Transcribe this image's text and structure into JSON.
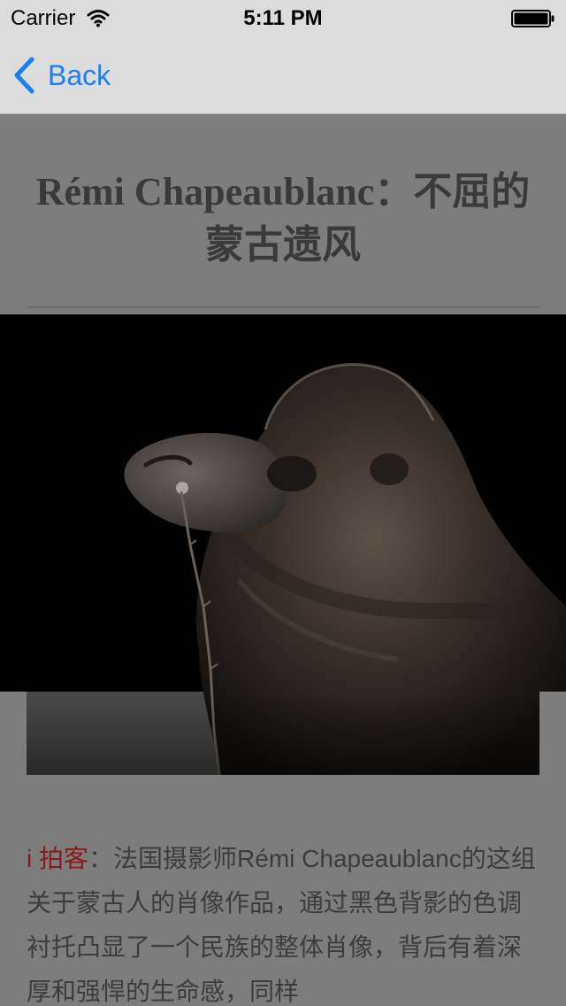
{
  "status_bar": {
    "carrier": "Carrier",
    "time": "5:11 PM"
  },
  "nav": {
    "back_label": "Back"
  },
  "article": {
    "title": "Rémi Chapeaublanc：不屈的蒙古遗风",
    "caption_label": "i 拍客",
    "caption_separator": "：",
    "caption_body": "法国摄影师Rémi Chapeaublanc的这组关于蒙古人的肖像作品，通过黑色背影的色调衬托凸显了一个民族的整体肖像，背后有着深厚和强悍的生命感，同样"
  },
  "colors": {
    "bar_background": "#dcdcdc",
    "accent_blue": "#1a7ff0",
    "page_background": "#7d7d7d",
    "caption_label_red": "#8a1a1a"
  }
}
